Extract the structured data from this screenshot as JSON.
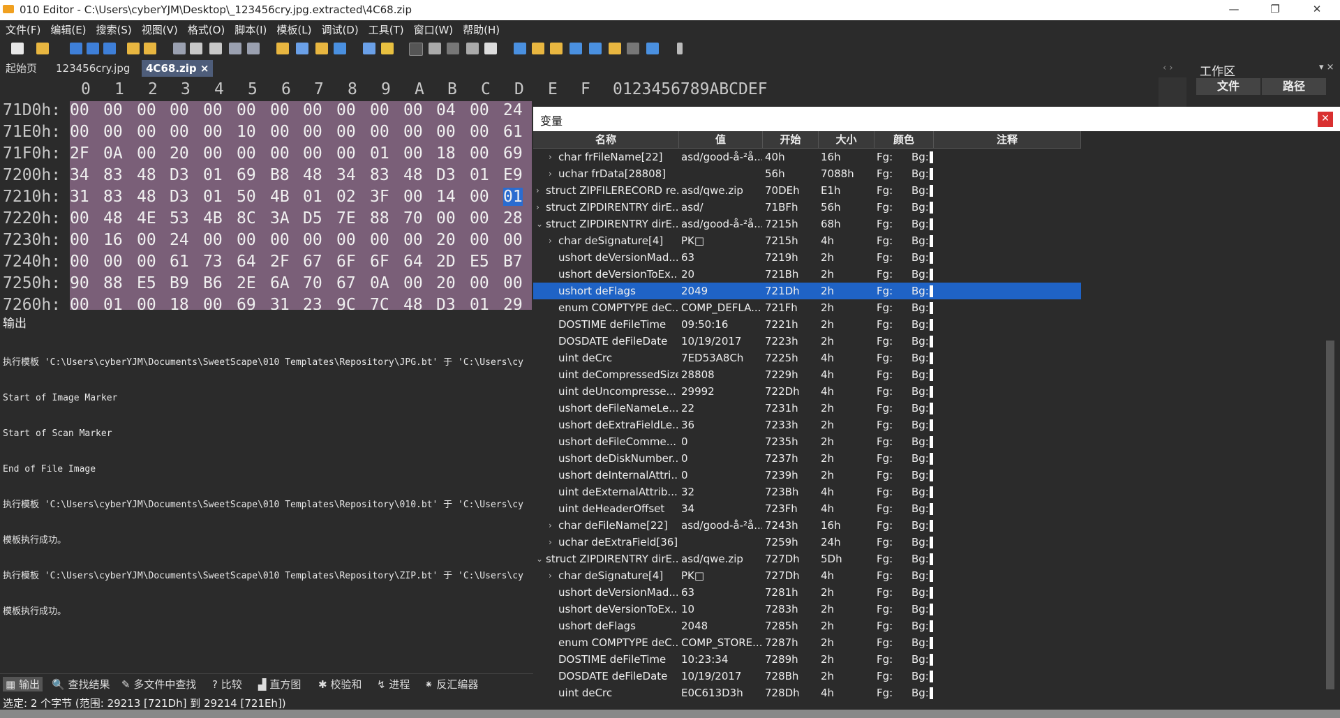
{
  "window": {
    "title": "010 Editor - C:\\Users\\cyberYJM\\Desktop\\_123456cry.jpg.extracted\\4C68.zip",
    "minimize": "—",
    "maximize": "❐",
    "close": "✕"
  },
  "menu": [
    "文件(F)",
    "编辑(E)",
    "搜索(S)",
    "视图(V)",
    "格式(O)",
    "脚本(I)",
    "模板(L)",
    "调试(D)",
    "工具(T)",
    "窗口(W)",
    "帮助(H)"
  ],
  "tabs": [
    {
      "label": "起始页"
    },
    {
      "label": "123456cry.jpg"
    },
    {
      "label": "4C68.zip ×"
    }
  ],
  "tab_arrows": "‹ › ▽",
  "hex": {
    "columns": [
      "0",
      "1",
      "2",
      "3",
      "4",
      "5",
      "6",
      "7",
      "8",
      "9",
      "A",
      "B",
      "C",
      "D",
      "E",
      "F"
    ],
    "ascii_header": "0123456789ABCDEF",
    "rows": [
      {
        "addr": "71D0h:",
        "bytes": [
          "00",
          "00",
          "00",
          "00",
          "00",
          "00",
          "00",
          "00",
          "00",
          "00",
          "00",
          "04",
          "00",
          "24"
        ]
      },
      {
        "addr": "71E0h:",
        "bytes": [
          "00",
          "00",
          "00",
          "00",
          "00",
          "10",
          "00",
          "00",
          "00",
          "00",
          "00",
          "00",
          "00",
          "61"
        ]
      },
      {
        "addr": "71F0h:",
        "bytes": [
          "2F",
          "0A",
          "00",
          "20",
          "00",
          "00",
          "00",
          "00",
          "00",
          "01",
          "00",
          "18",
          "00",
          "69"
        ]
      },
      {
        "addr": "7200h:",
        "bytes": [
          "34",
          "83",
          "48",
          "D3",
          "01",
          "69",
          "B8",
          "48",
          "34",
          "83",
          "48",
          "D3",
          "01",
          "E9"
        ]
      },
      {
        "addr": "7210h:",
        "bytes": [
          "31",
          "83",
          "48",
          "D3",
          "01",
          "50",
          "4B",
          "01",
          "02",
          "3F",
          "00",
          "14",
          "00",
          "01"
        ]
      },
      {
        "addr": "7220h:",
        "bytes": [
          "00",
          "48",
          "4E",
          "53",
          "4B",
          "8C",
          "3A",
          "D5",
          "7E",
          "88",
          "70",
          "00",
          "00",
          "28"
        ]
      },
      {
        "addr": "7230h:",
        "bytes": [
          "00",
          "16",
          "00",
          "24",
          "00",
          "00",
          "00",
          "00",
          "00",
          "00",
          "00",
          "20",
          "00",
          "00"
        ]
      },
      {
        "addr": "7240h:",
        "bytes": [
          "00",
          "00",
          "00",
          "61",
          "73",
          "64",
          "2F",
          "67",
          "6F",
          "6F",
          "64",
          "2D",
          "E5",
          "B7"
        ]
      },
      {
        "addr": "7250h:",
        "bytes": [
          "90",
          "88",
          "E5",
          "B9",
          "B6",
          "2E",
          "6A",
          "70",
          "67",
          "0A",
          "00",
          "20",
          "00",
          "00"
        ]
      },
      {
        "addr": "7260h:",
        "bytes": [
          "00",
          "01",
          "00",
          "18",
          "00",
          "69",
          "31",
          "23",
          "9C",
          "7C",
          "48",
          "D3",
          "01",
          "29"
        ]
      }
    ]
  },
  "output": {
    "title": "输出",
    "lines": [
      "执行模板 'C:\\Users\\cyberYJM\\Documents\\SweetScape\\010 Templates\\Repository\\JPG.bt' 于 'C:\\Users\\cy",
      "Start of Image Marker",
      "Start of Scan Marker",
      "End of File Image",
      "执行模板 'C:\\Users\\cyberYJM\\Documents\\SweetScape\\010 Templates\\Repository\\010.bt' 于 'C:\\Users\\cy",
      "模板执行成功。",
      "执行模板 'C:\\Users\\cyberYJM\\Documents\\SweetScape\\010 Templates\\Repository\\ZIP.bt' 于 'C:\\Users\\cy",
      "模板执行成功。"
    ]
  },
  "bottom_tabs": [
    "输出",
    "查找结果",
    "多文件中查找",
    "比较",
    "直方图",
    "校验和",
    "进程",
    "反汇编器"
  ],
  "status": "选定: 2 个字节 (范围: 29213 [721Dh] 到 29214 [721Eh])",
  "workspace": {
    "title": "工作区",
    "col_file": "文件",
    "col_path": "路径",
    "arrows": "▾ ×"
  },
  "variables": {
    "title": "变量",
    "close": "✕",
    "headers": {
      "name": "名称",
      "value": "值",
      "start": "开始",
      "size": "大小",
      "color": "颜色",
      "comment": "注释"
    },
    "rows": [
      {
        "expand": "›",
        "indent": 1,
        "name": "char frFileName[22]",
        "value": "asd/good-å-²å...",
        "start": "40h",
        "size": "16h",
        "fg": "Fg:",
        "bg": "Bg:"
      },
      {
        "expand": "›",
        "indent": 1,
        "name": "uchar frData[28808]",
        "value": "",
        "start": "56h",
        "size": "7088h",
        "fg": "Fg:",
        "bg": "Bg:"
      },
      {
        "expand": "›",
        "indent": 0,
        "name": "struct ZIPFILERECORD re...",
        "value": "asd/qwe.zip",
        "start": "70DEh",
        "size": "E1h",
        "fg": "Fg:",
        "bg": "Bg:"
      },
      {
        "expand": "›",
        "indent": 0,
        "name": "struct ZIPDIRENTRY dirE...",
        "value": "asd/",
        "start": "71BFh",
        "size": "56h",
        "fg": "Fg:",
        "bg": "Bg:"
      },
      {
        "expand": "⌄",
        "indent": 0,
        "name": "struct ZIPDIRENTRY dirE...",
        "value": "asd/good-å-²å...",
        "start": "7215h",
        "size": "68h",
        "fg": "Fg:",
        "bg": "Bg:"
      },
      {
        "expand": "›",
        "indent": 1,
        "name": "char deSignature[4]",
        "value": "PK□",
        "start": "7215h",
        "size": "4h",
        "fg": "Fg:",
        "bg": "Bg:"
      },
      {
        "expand": "",
        "indent": 1,
        "name": "ushort deVersionMad...",
        "value": "63",
        "start": "7219h",
        "size": "2h",
        "fg": "Fg:",
        "bg": "Bg:"
      },
      {
        "expand": "",
        "indent": 1,
        "name": "ushort deVersionToEx...",
        "value": "20",
        "start": "721Bh",
        "size": "2h",
        "fg": "Fg:",
        "bg": "Bg:"
      },
      {
        "expand": "",
        "indent": 1,
        "name": "ushort deFlags",
        "value": "2049",
        "start": "721Dh",
        "size": "2h",
        "fg": "Fg:",
        "bg": "Bg:",
        "selected": true
      },
      {
        "expand": "",
        "indent": 1,
        "name": "enum COMPTYPE deC...",
        "value": "COMP_DEFLA...",
        "start": "721Fh",
        "size": "2h",
        "fg": "Fg:",
        "bg": "Bg:"
      },
      {
        "expand": "",
        "indent": 1,
        "name": "DOSTIME deFileTime",
        "value": "09:50:16",
        "start": "7221h",
        "size": "2h",
        "fg": "Fg:",
        "bg": "Bg:"
      },
      {
        "expand": "",
        "indent": 1,
        "name": "DOSDATE deFileDate",
        "value": "10/19/2017",
        "start": "7223h",
        "size": "2h",
        "fg": "Fg:",
        "bg": "Bg:"
      },
      {
        "expand": "",
        "indent": 1,
        "name": "uint deCrc",
        "value": "7ED53A8Ch",
        "start": "7225h",
        "size": "4h",
        "fg": "Fg:",
        "bg": "Bg:"
      },
      {
        "expand": "",
        "indent": 1,
        "name": "uint deCompressedSize",
        "value": "28808",
        "start": "7229h",
        "size": "4h",
        "fg": "Fg:",
        "bg": "Bg:"
      },
      {
        "expand": "",
        "indent": 1,
        "name": "uint deUncompresse...",
        "value": "29992",
        "start": "722Dh",
        "size": "4h",
        "fg": "Fg:",
        "bg": "Bg:"
      },
      {
        "expand": "",
        "indent": 1,
        "name": "ushort deFileNameLe...",
        "value": "22",
        "start": "7231h",
        "size": "2h",
        "fg": "Fg:",
        "bg": "Bg:"
      },
      {
        "expand": "",
        "indent": 1,
        "name": "ushort deExtraFieldLe...",
        "value": "36",
        "start": "7233h",
        "size": "2h",
        "fg": "Fg:",
        "bg": "Bg:"
      },
      {
        "expand": "",
        "indent": 1,
        "name": "ushort deFileComme...",
        "value": "0",
        "start": "7235h",
        "size": "2h",
        "fg": "Fg:",
        "bg": "Bg:"
      },
      {
        "expand": "",
        "indent": 1,
        "name": "ushort deDiskNumber...",
        "value": "0",
        "start": "7237h",
        "size": "2h",
        "fg": "Fg:",
        "bg": "Bg:"
      },
      {
        "expand": "",
        "indent": 1,
        "name": "ushort deInternalAttri...",
        "value": "0",
        "start": "7239h",
        "size": "2h",
        "fg": "Fg:",
        "bg": "Bg:"
      },
      {
        "expand": "",
        "indent": 1,
        "name": "uint deExternalAttrib...",
        "value": "32",
        "start": "723Bh",
        "size": "4h",
        "fg": "Fg:",
        "bg": "Bg:"
      },
      {
        "expand": "",
        "indent": 1,
        "name": "uint deHeaderOffset",
        "value": "34",
        "start": "723Fh",
        "size": "4h",
        "fg": "Fg:",
        "bg": "Bg:"
      },
      {
        "expand": "›",
        "indent": 1,
        "name": "char deFileName[22]",
        "value": "asd/good-å-²å...",
        "start": "7243h",
        "size": "16h",
        "fg": "Fg:",
        "bg": "Bg:"
      },
      {
        "expand": "›",
        "indent": 1,
        "name": "uchar deExtraField[36]",
        "value": "",
        "start": "7259h",
        "size": "24h",
        "fg": "Fg:",
        "bg": "Bg:"
      },
      {
        "expand": "⌄",
        "indent": 0,
        "name": "struct ZIPDIRENTRY dirE...",
        "value": "asd/qwe.zip",
        "start": "727Dh",
        "size": "5Dh",
        "fg": "Fg:",
        "bg": "Bg:"
      },
      {
        "expand": "›",
        "indent": 1,
        "name": "char deSignature[4]",
        "value": "PK□",
        "start": "727Dh",
        "size": "4h",
        "fg": "Fg:",
        "bg": "Bg:"
      },
      {
        "expand": "",
        "indent": 1,
        "name": "ushort deVersionMad...",
        "value": "63",
        "start": "7281h",
        "size": "2h",
        "fg": "Fg:",
        "bg": "Bg:"
      },
      {
        "expand": "",
        "indent": 1,
        "name": "ushort deVersionToEx...",
        "value": "10",
        "start": "7283h",
        "size": "2h",
        "fg": "Fg:",
        "bg": "Bg:"
      },
      {
        "expand": "",
        "indent": 1,
        "name": "ushort deFlags",
        "value": "2048",
        "start": "7285h",
        "size": "2h",
        "fg": "Fg:",
        "bg": "Bg:"
      },
      {
        "expand": "",
        "indent": 1,
        "name": "enum COMPTYPE deC...",
        "value": "COMP_STORE...",
        "start": "7287h",
        "size": "2h",
        "fg": "Fg:",
        "bg": "Bg:"
      },
      {
        "expand": "",
        "indent": 1,
        "name": "DOSTIME deFileTime",
        "value": "10:23:34",
        "start": "7289h",
        "size": "2h",
        "fg": "Fg:",
        "bg": "Bg:"
      },
      {
        "expand": "",
        "indent": 1,
        "name": "DOSDATE deFileDate",
        "value": "10/19/2017",
        "start": "728Bh",
        "size": "2h",
        "fg": "Fg:",
        "bg": "Bg:"
      },
      {
        "expand": "",
        "indent": 1,
        "name": "uint deCrc",
        "value": "E0C613D3h",
        "start": "728Dh",
        "size": "4h",
        "fg": "Fg:",
        "bg": "Bg:"
      }
    ]
  }
}
